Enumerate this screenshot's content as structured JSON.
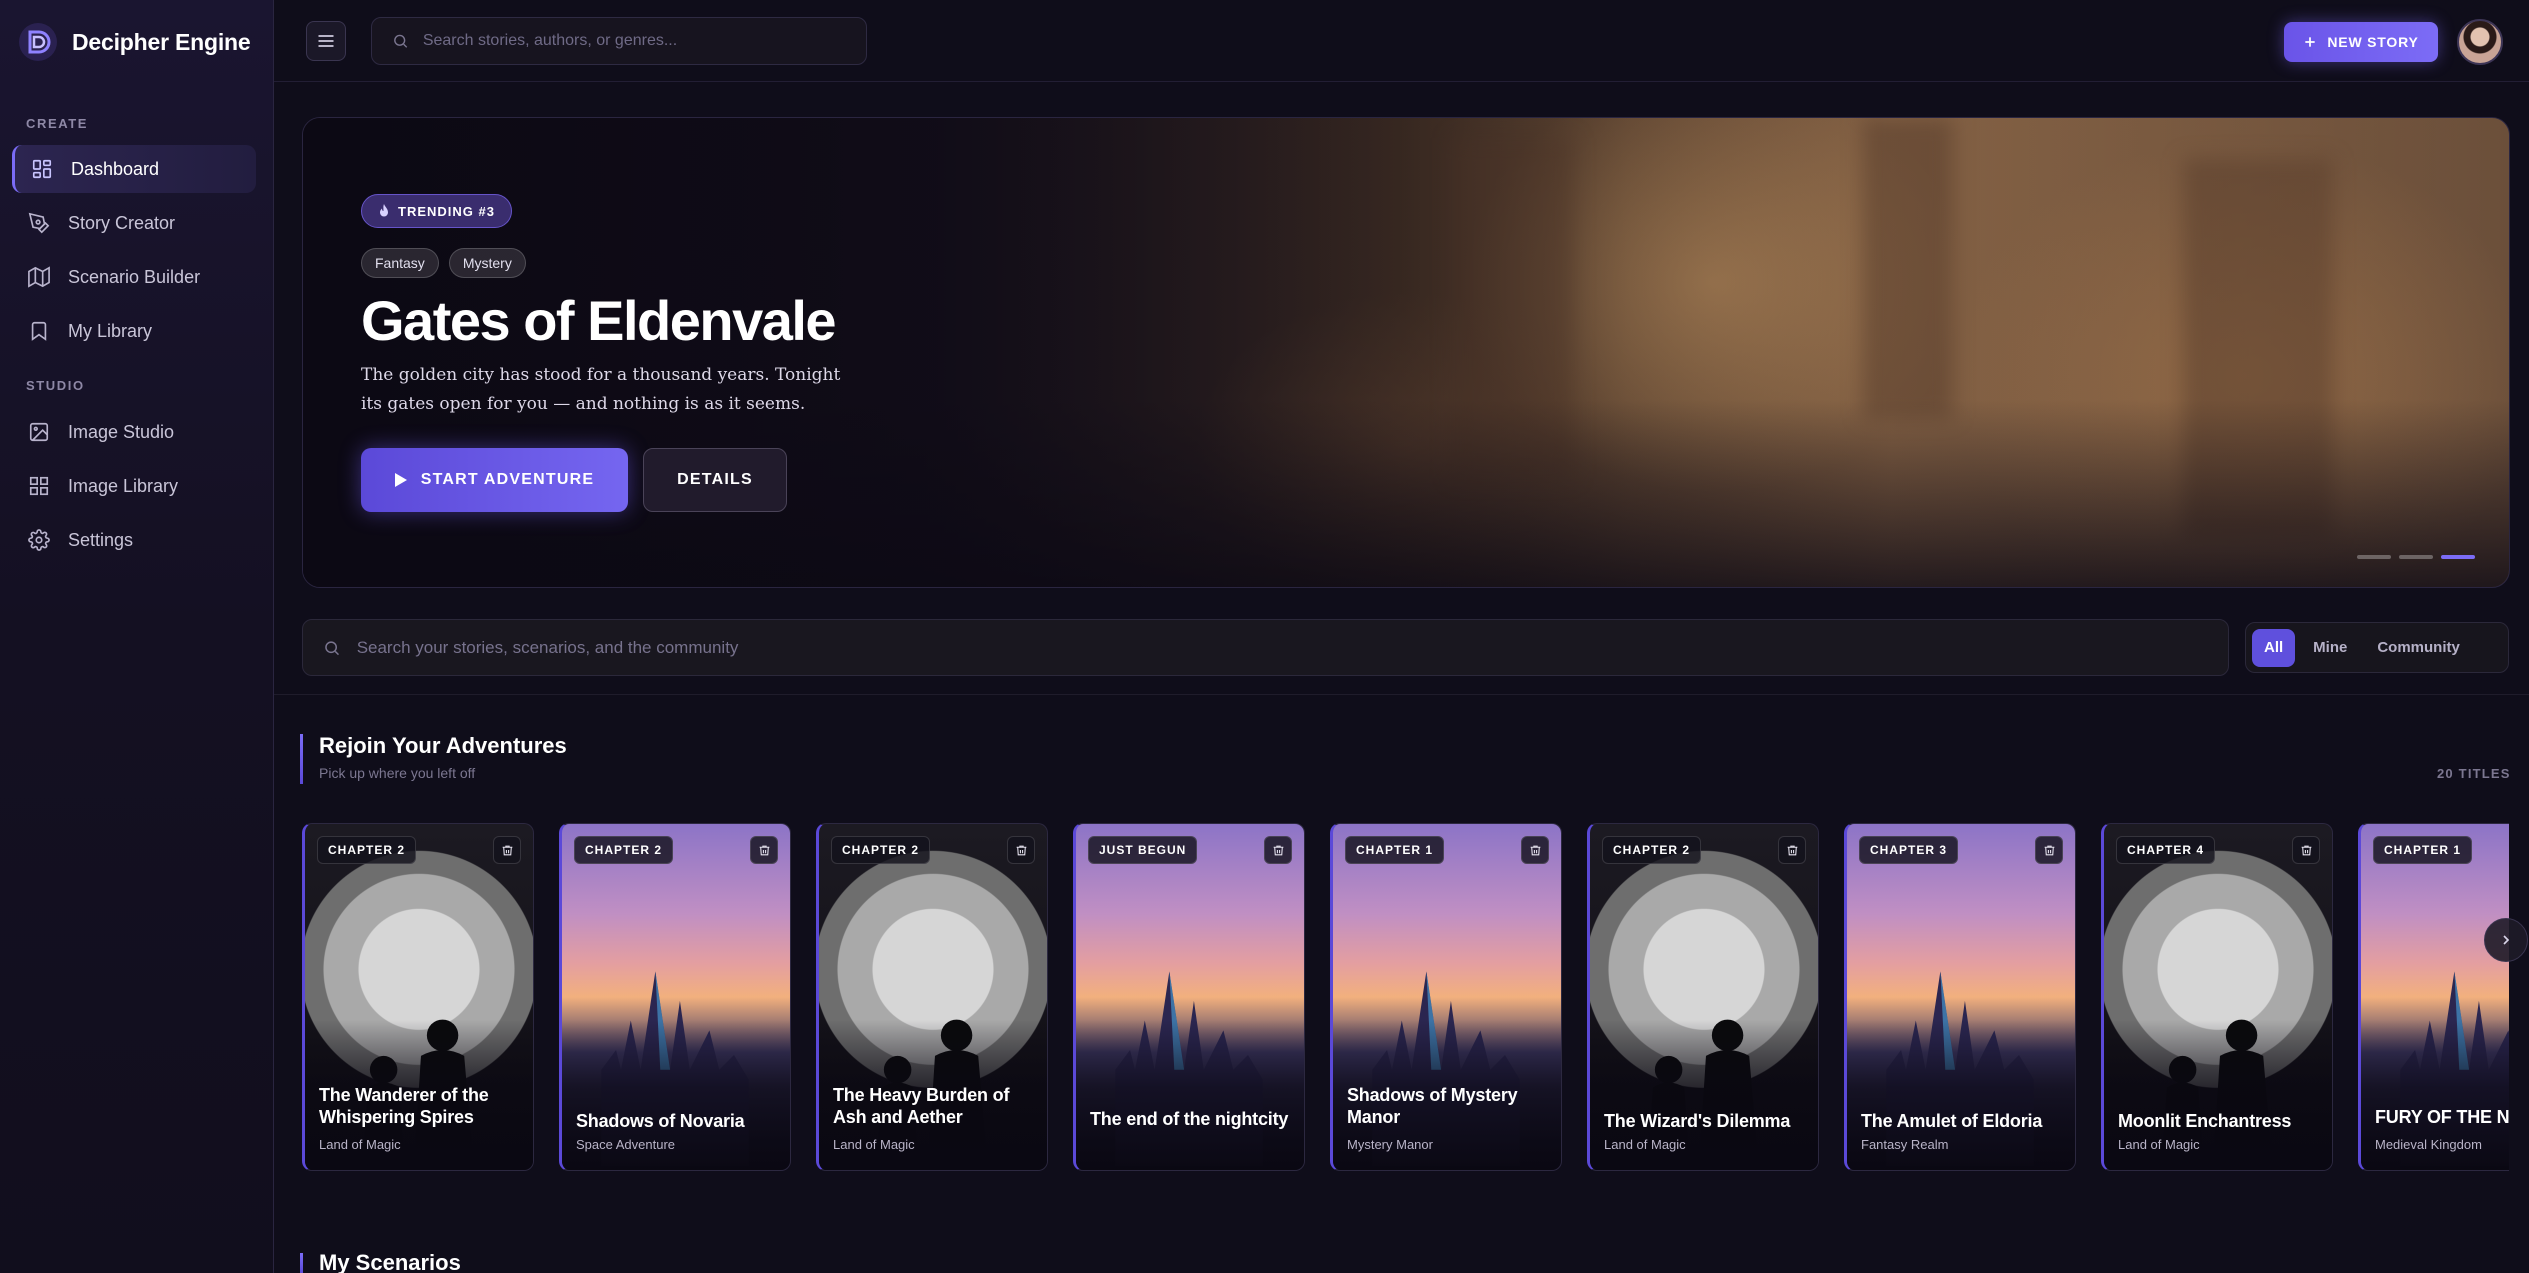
{
  "brand": {
    "name": "Decipher Engine"
  },
  "sidebar": {
    "sections": [
      {
        "label": "CREATE"
      },
      {
        "label": "STUDIO"
      }
    ],
    "items": [
      {
        "label": "Dashboard",
        "icon": "dashboard-grid-icon",
        "active": true
      },
      {
        "label": "Story Creator",
        "icon": "pen-nib-icon"
      },
      {
        "label": "Scenario Builder",
        "icon": "map-icon"
      },
      {
        "label": "My Library",
        "icon": "bookmark-icon"
      },
      {
        "label": "Image Studio",
        "icon": "image-icon"
      },
      {
        "label": "Image Library",
        "icon": "grid-icon"
      },
      {
        "label": "Settings",
        "icon": "gear-icon"
      }
    ]
  },
  "topbar": {
    "search_placeholder": "Search stories, authors, or genres...",
    "new_story_label": "NEW STORY"
  },
  "hero": {
    "badge": "TRENDING #3",
    "genres": [
      "Fantasy",
      "Mystery"
    ],
    "title": "Gates of Eldenvale",
    "description": "The golden city has stood for a thousand years. Tonight its gates open for you — and nothing is as it seems.",
    "start_label": "START ADVENTURE",
    "details_label": "DETAILS",
    "slides_total": 3,
    "slide_active": 3
  },
  "main_search": {
    "placeholder": "Search your stories, scenarios, and the community"
  },
  "filters": [
    {
      "label": "All",
      "active": true
    },
    {
      "label": "Mine"
    },
    {
      "label": "Community"
    }
  ],
  "rejoin": {
    "title": "Rejoin Your Adventures",
    "subtitle": "Pick up where you left off",
    "count": "20 TITLES",
    "cards": [
      {
        "chapter": "CHAPTER 2",
        "title": "The Wanderer of the Whispering Spires",
        "sub": "Land of Magic",
        "art": "moon"
      },
      {
        "chapter": "CHAPTER 2",
        "title": "Shadows of Novaria",
        "sub": "Space Adventure",
        "art": "castle"
      },
      {
        "chapter": "CHAPTER 2",
        "title": "The Heavy Burden of Ash and Aether",
        "sub": "Land of Magic",
        "art": "moon"
      },
      {
        "chapter": "JUST BEGUN",
        "title": "The end of the nightcity",
        "sub": "",
        "art": "castle"
      },
      {
        "chapter": "CHAPTER 1",
        "title": "Shadows of Mystery Manor",
        "sub": "Mystery Manor",
        "art": "castle"
      },
      {
        "chapter": "CHAPTER 2",
        "title": "The Wizard's Dilemma",
        "sub": "Land of Magic",
        "art": "moon"
      },
      {
        "chapter": "CHAPTER 3",
        "title": "The Amulet of Eldoria",
        "sub": "Fantasy Realm",
        "art": "castle"
      },
      {
        "chapter": "CHAPTER 4",
        "title": "Moonlit Enchantress",
        "sub": "Land of Magic",
        "art": "moon"
      },
      {
        "chapter": "CHAPTER 1",
        "title": "FURY OF THE NORTH WIND",
        "sub": "Medieval Kingdom",
        "art": "castle"
      }
    ]
  },
  "scenarios": {
    "title": "My Scenarios"
  },
  "colors": {
    "accent": "#7b6cf6",
    "background": "#0f0d1a",
    "sidebar": "#141022"
  }
}
